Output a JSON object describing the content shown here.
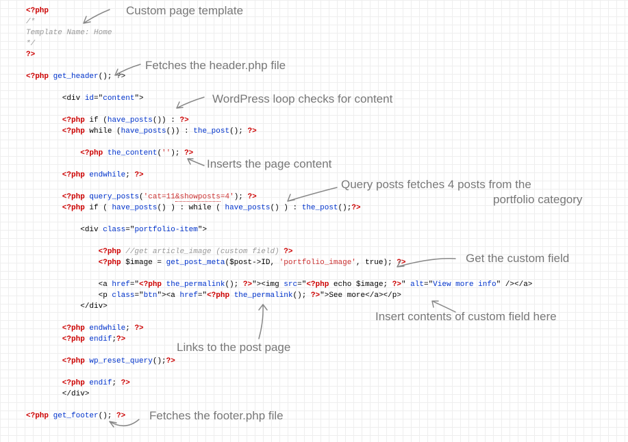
{
  "code": {
    "l1_open": "<?php",
    "l2": "/*",
    "l3": "Template Name: Home",
    "l4": "*/",
    "l5_close": "?>",
    "l7_open": "<?php",
    "l7_func": " get_header",
    "l7_close": "(); ?>",
    "l9_a": "        <div ",
    "l9_attr1": "id",
    "l9_b": "=\"",
    "l9_attr1v": "content",
    "l9_c": "\">",
    "l11_open": "        <?php",
    "l11_mid": " if (",
    "l11_func": "have_posts",
    "l11_end": "()) : ",
    "l11_close": "?>",
    "l12_open": "        <?php",
    "l12_mid": " while (",
    "l12_func": "have_posts",
    "l12_mid2": "()) : ",
    "l12_func2": "the_post",
    "l12_end": "(); ",
    "l12_close": "?>",
    "l14_open": "            <?php",
    "l14_func": " the_content",
    "l14_mid": "(",
    "l14_str": "''",
    "l14_end": "); ",
    "l14_close": "?>",
    "l16_open": "        <?php",
    "l16_kw": " endwhile",
    "l16_end": "; ",
    "l16_close": "?>",
    "l18_open": "        <?php",
    "l18_func": " query_posts",
    "l18_a": "(",
    "l18_str1": "'cat=11",
    "l18_str2": "&showposts",
    "l18_str3": "=4'",
    "l18_b": "); ",
    "l18_close": "?>",
    "l19_open": "        <?php",
    "l19_a": " if ( ",
    "l19_f1": "have_posts",
    "l19_b": "() ) : while ( ",
    "l19_f2": "have_posts",
    "l19_c": "() ) : ",
    "l19_f3": "the_post",
    "l19_d": "();",
    "l19_close": "?>",
    "l21_a": "            <div ",
    "l21_attr": "class",
    "l21_b": "=\"",
    "l21_v": "portfolio-item",
    "l21_c": "\">",
    "l23_open": "                <?php ",
    "l23_comment": "//get article_image (custom field)",
    "l23_close": " ?>",
    "l24_open": "                <?php",
    "l24_a": " $image = ",
    "l24_func": "get_post_meta",
    "l24_b": "($post->ID, ",
    "l24_str": "'portfolio_image'",
    "l24_c": ", true); ",
    "l24_close": "?>",
    "l26_a": "                <a ",
    "l26_attr1": "href",
    "l26_b": "=\"",
    "l26_php1": "<?php",
    "l26_func1": " the_permalink",
    "l26_c": "(); ",
    "l26_php2": "?>",
    "l26_d": "\"><img ",
    "l26_attr2": "src",
    "l26_e": "=\"",
    "l26_php3": "<?php",
    "l26_f": " echo $image; ",
    "l26_php4": "?>",
    "l26_g": "\" ",
    "l26_attr3": "alt",
    "l26_h": "=\"",
    "l26_alt": "View more info",
    "l26_i": "\" /></a>",
    "l27_a": "                <p ",
    "l27_attr1": "class",
    "l27_b": "=\"",
    "l27_v1": "btn",
    "l27_c": "\"><a ",
    "l27_attr2": "href",
    "l27_d": "=\"",
    "l27_php1": "<?php",
    "l27_func1": " the_permalink",
    "l27_e": "(); ",
    "l27_php2": "?>",
    "l27_f": "\">See more</a></p>",
    "l28": "            </div>",
    "l30_open": "        <?php",
    "l30_kw": " endwhile",
    "l30_e": "; ",
    "l30_close": "?>",
    "l31_open": "        <?php",
    "l31_kw": " endif",
    "l31_e": ";",
    "l31_close": "?>",
    "l33_open": "        <?php",
    "l33_func": " wp_reset_query",
    "l33_e": "();",
    "l33_close": "?>",
    "l35_open": "        <?php",
    "l35_kw": " endif",
    "l35_e": "; ",
    "l35_close": "?>",
    "l36": "        </div>",
    "l38_open": "<?php",
    "l38_func": " get_footer",
    "l38_e": "(); ",
    "l38_close": "?>"
  },
  "annotations": {
    "a1": "Custom page template",
    "a2": "Fetches the header.php file",
    "a3": "WordPress loop checks for content",
    "a4": "Inserts the page content",
    "a5a": "Query posts fetches 4 posts from the",
    "a5b": "portfolio category",
    "a6": "Get the custom field",
    "a7": "Insert contents of custom field here",
    "a8": "Links to the post page",
    "a9": "Fetches the footer.php file"
  }
}
